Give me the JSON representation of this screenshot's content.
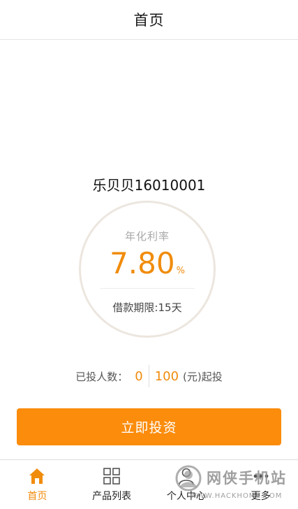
{
  "header": {
    "title": "首页"
  },
  "product": {
    "name": "乐贝贝16010001",
    "rate_label": "年化利率",
    "rate_value": "7.80",
    "rate_unit": "%",
    "term": "借款期限:15天"
  },
  "investment": {
    "investors_label": "已投人数：",
    "investors_count": "0",
    "min_amount": "100",
    "min_amount_suffix": "(元)起投"
  },
  "cta": {
    "label": "立即投资"
  },
  "tabbar": {
    "items": [
      {
        "label": "首页",
        "icon": "home-icon",
        "active": true
      },
      {
        "label": "产品列表",
        "icon": "grid-icon",
        "active": false
      },
      {
        "label": "个人中心",
        "icon": "user-icon",
        "active": false
      },
      {
        "label": "更多",
        "icon": "more-icon",
        "active": false
      }
    ]
  },
  "watermark": {
    "text": "网侠手机站",
    "url": "WWW.HACKHOME.COM"
  },
  "colors": {
    "accent": "#fb8c0c",
    "accent_text": "#f08c0c",
    "circle": "#ece6df"
  }
}
